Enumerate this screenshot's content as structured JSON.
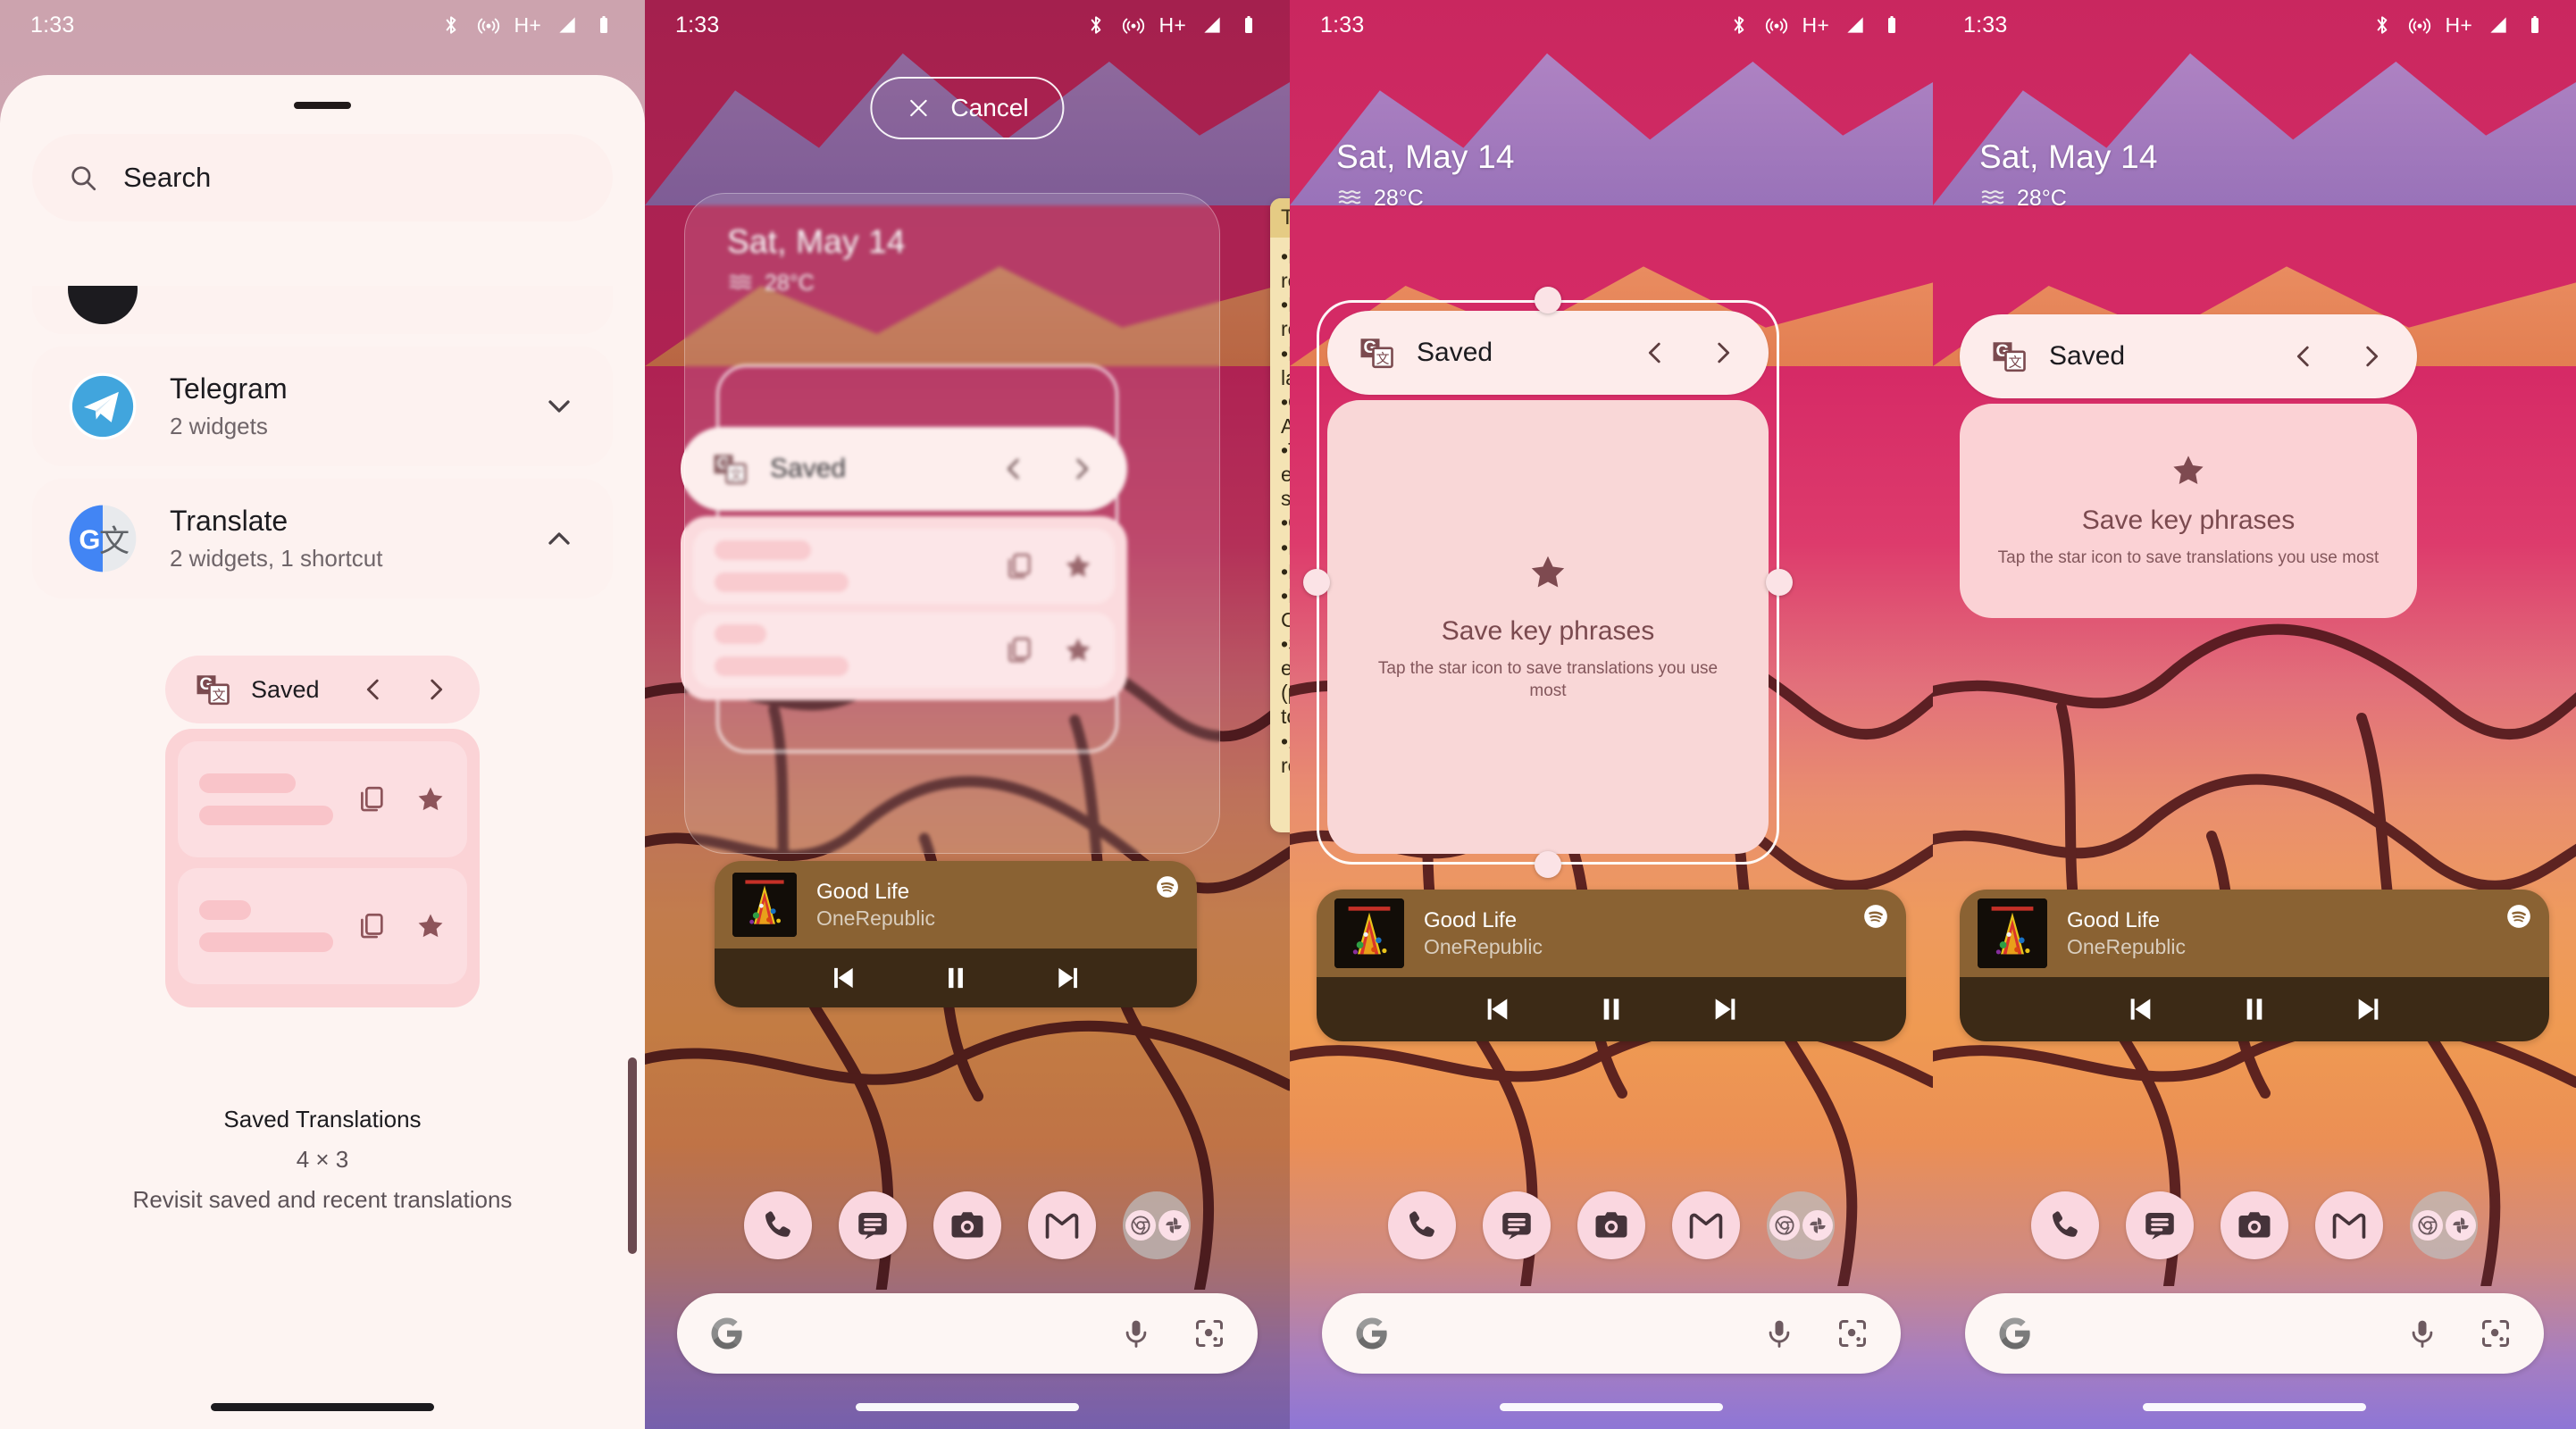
{
  "status_bar": {
    "time": "1:33",
    "icons": [
      "bluetooth-icon",
      "hotspot-icon",
      "network-hplus-icon",
      "signal-icon",
      "battery-icon"
    ],
    "network_label": "H+"
  },
  "panel1_widget_picker": {
    "search": {
      "placeholder": "Search",
      "icon": "search-icon"
    },
    "apps": [
      {
        "name": "Telegram",
        "subtitle": "2 widgets",
        "icon": "telegram-icon",
        "expanded": false,
        "chevron": "chevron-down-icon"
      },
      {
        "name": "Translate",
        "subtitle": "2 widgets, 1 shortcut",
        "icon": "google-translate-icon",
        "expanded": true,
        "chevron": "chevron-up-icon"
      }
    ],
    "preview_widget": {
      "header_title": "Saved",
      "header_icon": "google-translate-icon",
      "prev_icon": "chevron-left-icon",
      "next_icon": "chevron-right-icon",
      "rows": [
        {
          "copy_icon": "copy-icon",
          "star_icon": "star-icon"
        },
        {
          "copy_icon": "copy-icon",
          "star_icon": "star-icon"
        }
      ]
    },
    "caption": {
      "title": "Saved Translations",
      "size": "4 × 3",
      "description": "Revisit saved and recent translations"
    }
  },
  "panel2_drag": {
    "cancel_label": "Cancel",
    "cancel_icon": "close-icon",
    "note_widget": {
      "title": "To",
      "lines": [
        "•Hu",
        "rev",
        "•Eb",
        "rev",
        "•EC",
        "lan",
        "•On",
        "Air",
        "•Tr",
        "ear",
        "spe",
        "•Ca",
        "•Bl",
        "•Fa",
        "•Fi",
        "Ca",
        "•Su",
        "eve",
        "(pr",
        "tor",
        "•1 ",
        "rele"
      ]
    }
  },
  "home_screen": {
    "date": "Sat, May 14",
    "temperature": "28°C",
    "weather_icon": "haze-icon",
    "translate_widget": {
      "header_title": "Saved",
      "header_icon": "google-translate-icon",
      "prev_icon": "chevron-left-icon",
      "next_icon": "chevron-right-icon",
      "empty_title": "Save key phrases",
      "empty_subtitle": "Tap the star icon to save translations you use most",
      "empty_icon": "star-icon"
    },
    "music_widget": {
      "track": "Good Life",
      "artist": "OneRepublic",
      "app_icon": "spotify-icon",
      "controls": [
        "previous-track-icon",
        "pause-icon",
        "next-track-icon"
      ]
    },
    "dock": [
      {
        "name": "Phone",
        "icon": "phone-icon"
      },
      {
        "name": "Messages",
        "icon": "messages-icon"
      },
      {
        "name": "Camera",
        "icon": "camera-icon"
      },
      {
        "name": "Gmail",
        "icon": "gmail-icon"
      },
      {
        "name": "Folder",
        "icon": "folder-icon",
        "contents": [
          "chrome-icon",
          "photos-icon"
        ]
      }
    ],
    "search_bar": {
      "logo_icon": "google-g-icon",
      "mic_icon": "microphone-icon",
      "lens_icon": "google-lens-icon"
    }
  },
  "colors": {
    "sheet_bg": "#fdf4f2",
    "widget_head_bg": "#fdeceb",
    "widget_body_bg": "#f9d7d7",
    "accent_maroon": "#7b4a4f",
    "music_bg": "#8a6233",
    "music_ctl_bg": "#3c2a16",
    "wallpaper_top": "#c9275f",
    "dock_icon_bg": "#fad7e0"
  }
}
